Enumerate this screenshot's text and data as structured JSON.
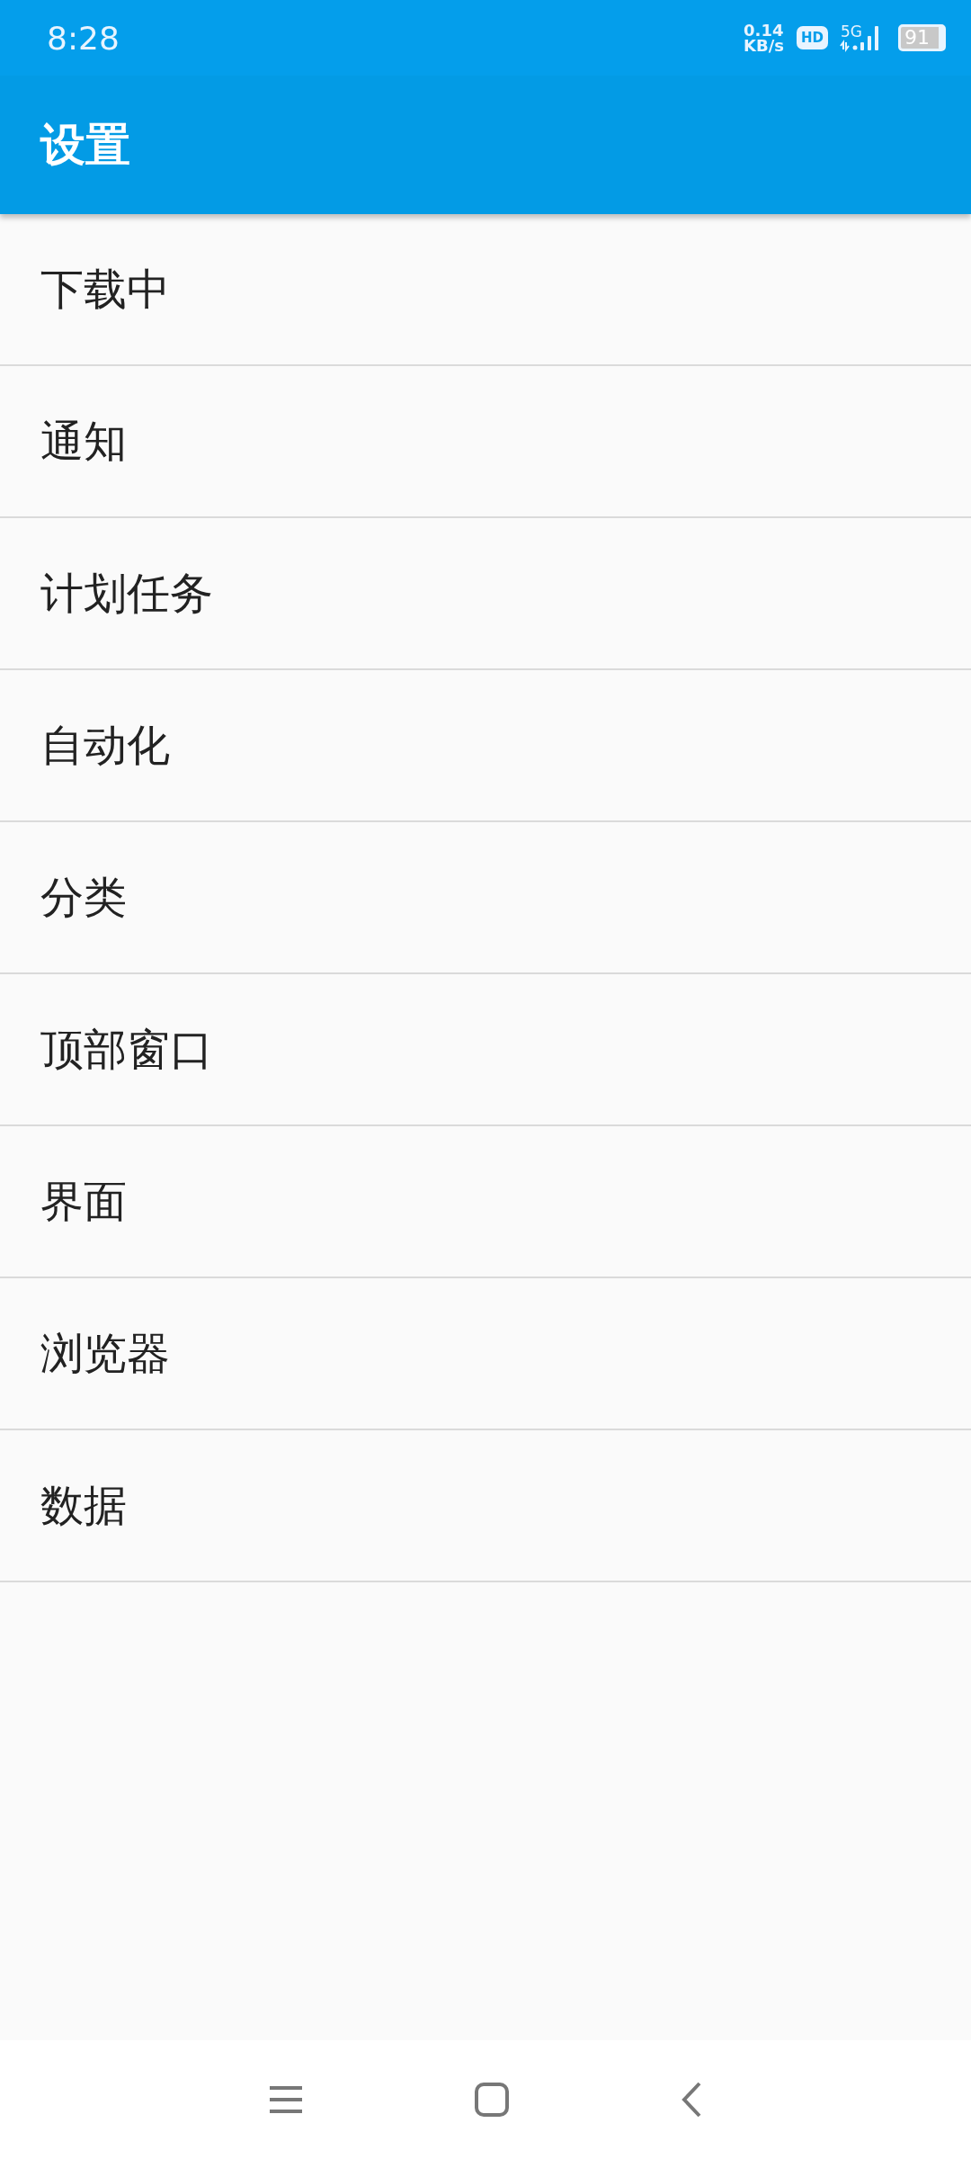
{
  "status_bar": {
    "time": "8:28",
    "net_speed": "0.14",
    "net_unit": "KB/s",
    "hd_badge": "HD",
    "network": "5G",
    "battery": "91"
  },
  "app_bar": {
    "title": "设置"
  },
  "items": [
    {
      "label": "下载中"
    },
    {
      "label": "通知"
    },
    {
      "label": "计划任务"
    },
    {
      "label": "自动化"
    },
    {
      "label": "分类"
    },
    {
      "label": "顶部窗口"
    },
    {
      "label": "界面"
    },
    {
      "label": "浏览器"
    },
    {
      "label": "数据"
    }
  ]
}
